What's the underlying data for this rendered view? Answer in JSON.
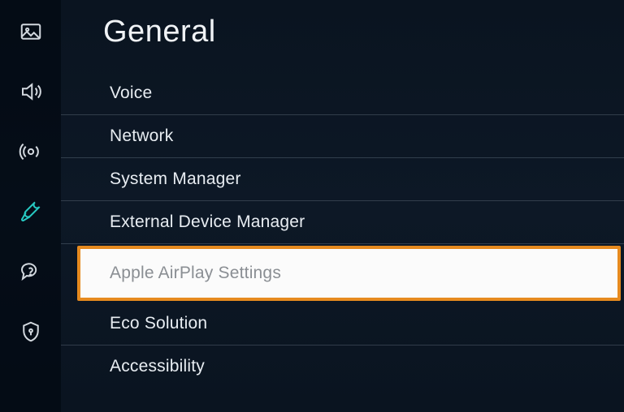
{
  "sidebar": {
    "items": [
      {
        "name": "picture-icon"
      },
      {
        "name": "sound-icon"
      },
      {
        "name": "broadcasting-icon"
      },
      {
        "name": "general-icon",
        "active": true
      },
      {
        "name": "support-icon"
      },
      {
        "name": "privacy-icon"
      }
    ]
  },
  "page": {
    "title": "General"
  },
  "menu": {
    "items": [
      {
        "label": "Voice",
        "selected": false
      },
      {
        "label": "Network",
        "selected": false
      },
      {
        "label": "System Manager",
        "selected": false
      },
      {
        "label": "External Device Manager",
        "selected": false
      },
      {
        "label": "Apple AirPlay Settings",
        "selected": true,
        "highlighted": true
      },
      {
        "label": "Eco Solution",
        "selected": false
      },
      {
        "label": "Accessibility",
        "selected": false
      }
    ]
  },
  "colors": {
    "accent": "#27c9c2",
    "highlight_border": "#e68a1f",
    "selected_bg": "#fbfbfb",
    "selected_text": "#8a8e93"
  }
}
